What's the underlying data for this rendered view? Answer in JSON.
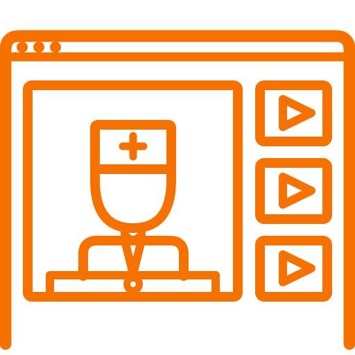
{
  "icon": {
    "name": "online-doctor-video-consultation",
    "color": "#F57100",
    "window_dots": 3,
    "thumbnails": [
      {
        "name": "video-thumbnail-1",
        "icon": "play-icon"
      },
      {
        "name": "video-thumbnail-2",
        "icon": "play-icon"
      },
      {
        "name": "video-thumbnail-3",
        "icon": "play-icon"
      }
    ]
  }
}
